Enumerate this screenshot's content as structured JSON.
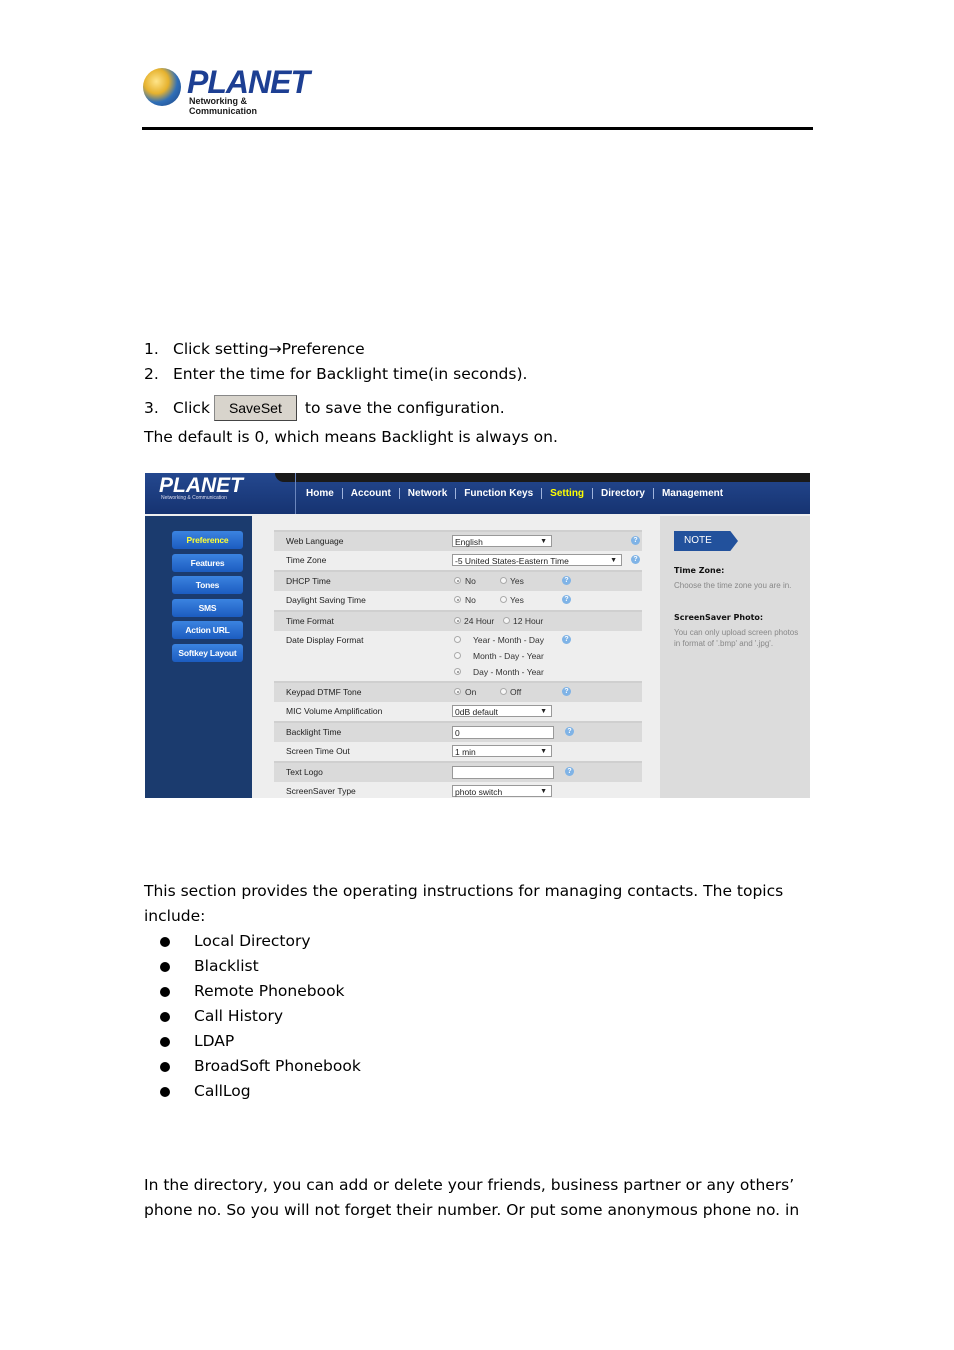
{
  "brand": {
    "name": "PLANET",
    "tagline": "Networking & Communication"
  },
  "steps": [
    {
      "num": "1.",
      "text": "Click setting→Preference"
    },
    {
      "num": "2.",
      "text": "Enter the time for Backlight time(in seconds)."
    },
    {
      "num": "3.",
      "before": "Click",
      "button": "SaveSet",
      "after": "to save the configuration."
    }
  ],
  "default_note": "The default is 0, which means Backlight is always on.",
  "screenshot": {
    "logo": "PLANET",
    "logo_sub": "Networking & Communication",
    "nav": [
      {
        "label": "Home",
        "active": false
      },
      {
        "label": "Account",
        "active": false
      },
      {
        "label": "Network",
        "active": false
      },
      {
        "label": "Function Keys",
        "active": false
      },
      {
        "label": "Setting",
        "active": true
      },
      {
        "label": "Directory",
        "active": false
      },
      {
        "label": "Management",
        "active": false
      }
    ],
    "sidebar": [
      {
        "label": "Preference",
        "active": true
      },
      {
        "label": "Features",
        "active": false
      },
      {
        "label": "Tones",
        "active": false
      },
      {
        "label": "SMS",
        "active": false
      },
      {
        "label": "Action URL",
        "active": false
      },
      {
        "label": "Softkey Layout",
        "active": false
      }
    ],
    "fields": {
      "web_language": {
        "label": "Web Language",
        "value": "English"
      },
      "time_zone": {
        "label": "Time Zone",
        "value": "-5 United States-Eastern Time"
      },
      "dhcp_time": {
        "label": "DHCP Time",
        "options": [
          "No",
          "Yes"
        ],
        "selected": "No"
      },
      "daylight_saving": {
        "label": "Daylight Saving Time",
        "options": [
          "No",
          "Yes"
        ],
        "selected": "No"
      },
      "time_format": {
        "label": "Time Format",
        "options": [
          "24 Hour",
          "12 Hour"
        ],
        "selected": "24 Hour"
      },
      "date_format": {
        "label": "Date Display Format",
        "options": [
          "Year - Month - Day",
          "Month - Day - Year",
          "Day - Month - Year"
        ],
        "selected": "Day - Month - Year"
      },
      "keypad_dtmf": {
        "label": "Keypad DTMF Tone",
        "options": [
          "On",
          "Off"
        ],
        "selected": "On"
      },
      "mic_volume": {
        "label": "MIC Volume Amplification",
        "value": "0dB default"
      },
      "backlight_time": {
        "label": "Backlight Time",
        "value": "0"
      },
      "screen_timeout": {
        "label": "Screen Time Out",
        "value": "1 min"
      },
      "text_logo": {
        "label": "Text Logo",
        "value": ""
      },
      "screensaver_type": {
        "label": "ScreenSaver Type",
        "value": "photo switch"
      }
    },
    "note": {
      "tag": "NOTE",
      "items": [
        {
          "head": "Time Zone:",
          "text": "Choose the time zone you are in."
        },
        {
          "head": "ScreenSaver Photo:",
          "text": "You can only upload screen photos in format of '.bmp' and '.jpg'."
        }
      ]
    }
  },
  "intro": "This section provides the operating instructions for managing contacts. The topics include:",
  "topics": [
    "Local Directory",
    "Blacklist",
    "Remote Phonebook",
    "Call History",
    "LDAP",
    "BroadSoft Phonebook",
    "CallLog"
  ],
  "directory_para": "In the directory, you can add or delete your friends, business partner or any others’ phone no. So you will not forget their number. Or put some anonymous phone no. in"
}
